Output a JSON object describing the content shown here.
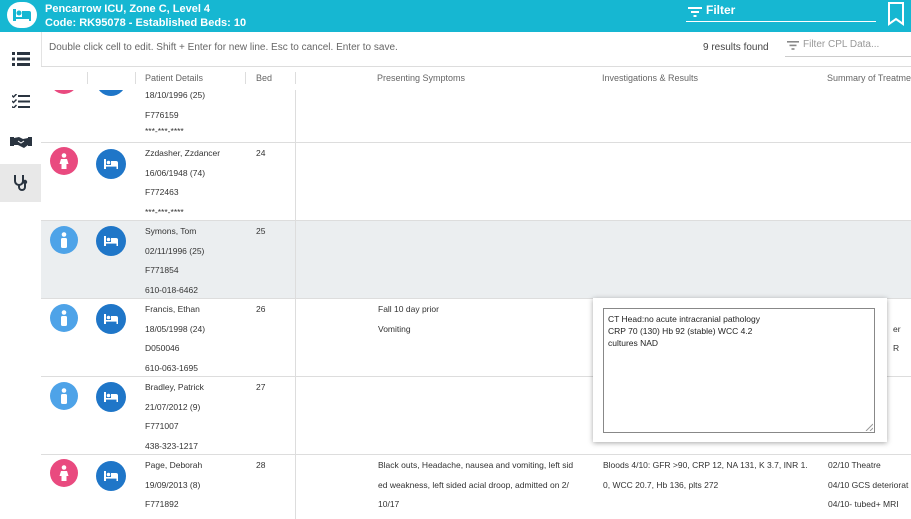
{
  "header": {
    "ward_line": "Pencarrow ICU, Zone C, Level 4",
    "code_line": "Code: RK95078 - Established Beds: 10",
    "filter_label": "Filter",
    "ward_icon": "bed-icon",
    "filter_icon": "filter-icon",
    "bookmark_icon": "bookmark-icon"
  },
  "sidebar": {
    "items": [
      {
        "icon": "list-icon"
      },
      {
        "icon": "checklist-icon"
      },
      {
        "icon": "handshake-icon"
      },
      {
        "icon": "stethoscope-icon",
        "active": true
      }
    ]
  },
  "toolbar": {
    "hint": "Double click cell to edit. Shift + Enter for new line. Esc to cancel. Enter to save.",
    "results": "9 results found",
    "filter_placeholder": "Filter CPL Data..."
  },
  "columns": {
    "details": "Patient Details",
    "bed": "Bed",
    "symptoms": "Presenting Symptoms",
    "investigations": "Investigations & Results",
    "summary": "Summary of Treatment"
  },
  "colors": {
    "brand": "#16b7d2",
    "female": "#e94a7f",
    "male": "#4ea3e8",
    "bed_button": "#1f76c8"
  },
  "rows": [
    {
      "gender": "female",
      "dob": "18/10/1996 (25)",
      "mrn": "F776159",
      "nhi": "***-***-****"
    },
    {
      "gender": "female",
      "name": "Zzdasher, Zzdancer",
      "bed": "24",
      "dob": "16/06/1948 (74)",
      "mrn": "F772463",
      "nhi": "***-***-****"
    },
    {
      "gender": "male",
      "name": "Symons, Tom",
      "bed": "25",
      "dob": "02/11/1996 (25)",
      "mrn": "F771854",
      "nhi": "610-018-6462",
      "selected": true
    },
    {
      "gender": "male",
      "name": "Francis, Ethan",
      "bed": "26",
      "dob": "18/05/1998 (24)",
      "mrn": "D050046",
      "nhi": "610-063-1695",
      "symptoms": [
        "Fall 10 day prior",
        "Vomiting"
      ],
      "summary": [
        "er",
        "R"
      ]
    },
    {
      "gender": "male",
      "name": "Bradley, Patrick",
      "bed": "27",
      "dob": "21/07/2012 (9)",
      "mrn": "F771007",
      "nhi": "438-323-1217"
    },
    {
      "gender": "female",
      "name": "Page, Deborah",
      "bed": "28",
      "dob": "19/09/2013 (8)",
      "mrn": "F771892",
      "symptoms": [
        "Black outs, Headache, nausea and vomiting, left sid",
        "ed weakness, left sided acial droop, admitted on 2/",
        "10/17"
      ],
      "investigations": [
        "Bloods 4/10: GFR >90, CRP 12, NA 131, K 3.7, INR 1.",
        "0, WCC 20.7, Hb 136, plts 272"
      ],
      "summary": [
        "02/10 Theatre",
        "04/10 GCS deteriorat",
        "04/10- tubed+ MRI"
      ]
    }
  ],
  "editor": {
    "line1": "CT Head:no acute intracranial pathology",
    "line2": "CRP 70 (130) Hb 92 (stable) WCC 4.2",
    "line3": "cultures NAD"
  }
}
